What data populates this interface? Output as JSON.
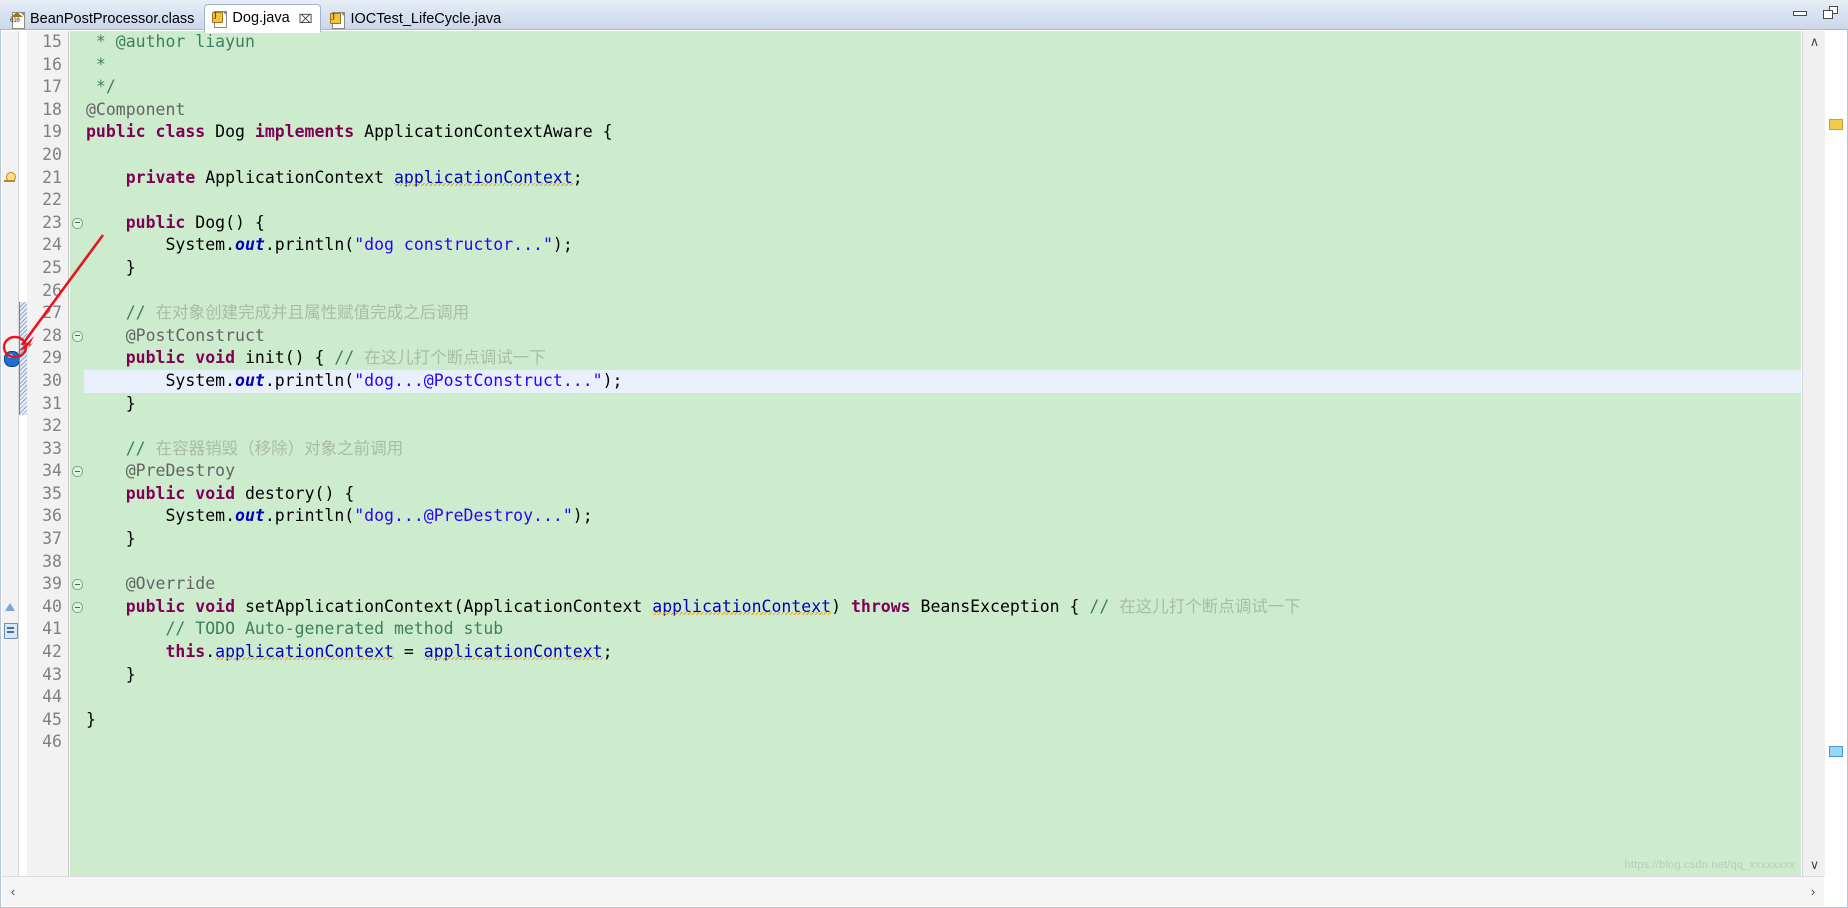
{
  "window": {
    "minimize_label": "Minimize",
    "restore_label": "Restore"
  },
  "tabbar": {
    "tabs": [
      {
        "label": "BeanPostProcessor.class",
        "icon": "class-file-icon",
        "active": false,
        "closable": false
      },
      {
        "label": "Dog.java",
        "icon": "java-file-icon",
        "active": true,
        "closable": true,
        "close_glyph": "⌧"
      },
      {
        "label": "IOCTest_LifeCycle.java",
        "icon": "java-file-icon",
        "active": false,
        "closable": false
      }
    ]
  },
  "editor": {
    "file": "Dog.java",
    "first_visible_line": 15,
    "last_visible_line": 46,
    "current_line": 30,
    "breakpoint_line": 29,
    "line_numbers": [
      "15",
      "16",
      "17",
      "18",
      "19",
      "20",
      "21",
      "22",
      "23",
      "24",
      "25",
      "26",
      "27",
      "28",
      "29",
      "30",
      "31",
      "32",
      "33",
      "34",
      "35",
      "36",
      "37",
      "38",
      "39",
      "40",
      "41",
      "42",
      "43",
      "44",
      "45",
      "46"
    ],
    "lines": [
      {
        "n": "15",
        "text": " * @author liayun"
      },
      {
        "n": "16",
        "text": " *"
      },
      {
        "n": "17",
        "text": " */"
      },
      {
        "n": "18",
        "text": "@Component"
      },
      {
        "n": "19",
        "text": "public class Dog implements ApplicationContextAware {"
      },
      {
        "n": "20",
        "text": ""
      },
      {
        "n": "21",
        "text": "    private ApplicationContext applicationContext;"
      },
      {
        "n": "22",
        "text": ""
      },
      {
        "n": "23",
        "text": "    public Dog() {"
      },
      {
        "n": "24",
        "text": "        System.out.println(\"dog constructor...\");"
      },
      {
        "n": "25",
        "text": "    }"
      },
      {
        "n": "26",
        "text": ""
      },
      {
        "n": "27",
        "text": "    // 在对象创建完成并且属性赋值完成之后调用"
      },
      {
        "n": "28",
        "text": "    @PostConstruct"
      },
      {
        "n": "29",
        "text": "    public void init() { // 在这儿打个断点调试一下"
      },
      {
        "n": "30",
        "text": "        System.out.println(\"dog...@PostConstruct...\");"
      },
      {
        "n": "31",
        "text": "    }"
      },
      {
        "n": "32",
        "text": ""
      },
      {
        "n": "33",
        "text": "    // 在容器销毁（移除）对象之前调用"
      },
      {
        "n": "34",
        "text": "    @PreDestroy"
      },
      {
        "n": "35",
        "text": "    public void destory() {"
      },
      {
        "n": "36",
        "text": "        System.out.println(\"dog...@PreDestroy...\");"
      },
      {
        "n": "37",
        "text": "    }"
      },
      {
        "n": "38",
        "text": ""
      },
      {
        "n": "39",
        "text": "    @Override"
      },
      {
        "n": "40",
        "text": "    public void setApplicationContext(ApplicationContext applicationContext) throws BeansException { // 在这儿打个断点调试一下"
      },
      {
        "n": "41",
        "text": "        // TODO Auto-generated method stub"
      },
      {
        "n": "42",
        "text": "        this.applicationContext = applicationContext;"
      },
      {
        "n": "43",
        "text": "    }"
      },
      {
        "n": "44",
        "text": ""
      },
      {
        "n": "45",
        "text": "}"
      },
      {
        "n": "46",
        "text": ""
      }
    ],
    "gutter_markers": [
      {
        "line": "21",
        "type": "warning-bulb-icon"
      },
      {
        "line": "29",
        "type": "breakpoint-icon"
      },
      {
        "line": "40",
        "type": "override-triangle-icon"
      },
      {
        "line": "41",
        "type": "todo-marker-icon"
      }
    ],
    "folding_markers": [
      "23",
      "28",
      "34",
      "39",
      "40"
    ],
    "overview_markers": [
      {
        "type": "warning-marker",
        "color": "#f2c94c"
      },
      {
        "type": "info-marker",
        "color": "#9fd3f5"
      }
    ]
  },
  "annotation": {
    "type": "red-arrow",
    "points_to": "breakpoint at line 29",
    "color": "#e8141e"
  },
  "scrollbars": {
    "vertical": {
      "up_glyph": "∧",
      "down_glyph": "∨"
    },
    "horizontal": {
      "left_glyph": "‹",
      "right_glyph": "›"
    }
  },
  "watermark": {
    "text": "https://blog.csdn.net/qq_xxxxxxxx"
  },
  "colors": {
    "code_background": "#cdeccd",
    "current_line": "#e8f0fb",
    "keyword": "#7f0055",
    "string": "#2a00ff",
    "comment": "#3f7f5f",
    "annotation_arrow": "#e8141e",
    "tabbar": "#d6e0ef"
  }
}
